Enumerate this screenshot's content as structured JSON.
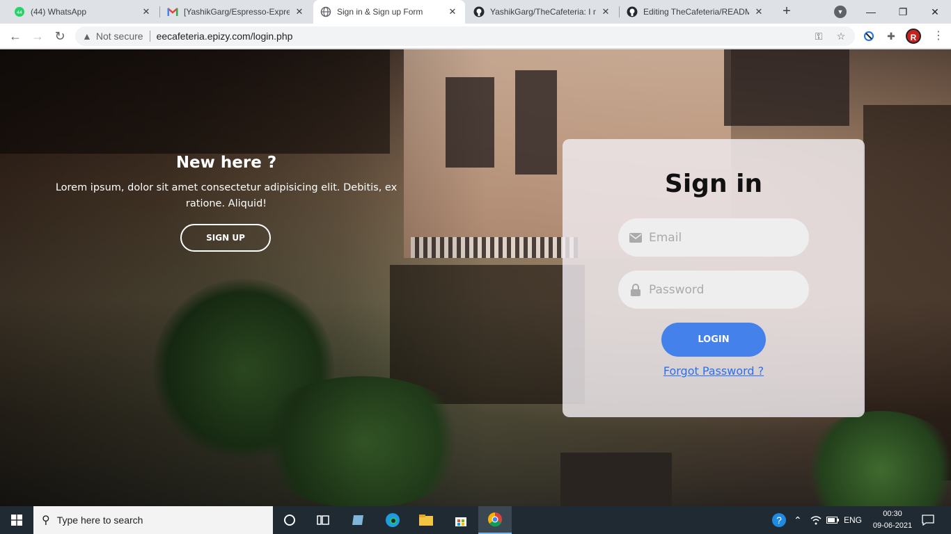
{
  "browser": {
    "tabs": [
      {
        "title": "(44) WhatsApp",
        "icon": "whatsapp-icon",
        "badge": "44"
      },
      {
        "title": "[YashikGarg/Espresso-Express",
        "icon": "gmail-icon"
      },
      {
        "title": "Sign in & Sign up Form",
        "icon": "globe-icon",
        "active": true
      },
      {
        "title": "YashikGarg/TheCafeteria: I m",
        "icon": "github-icon"
      },
      {
        "title": "Editing TheCafeteria/READM",
        "icon": "github-icon"
      }
    ],
    "omnibox": {
      "security_label": "Not secure",
      "url": "eecafeteria.epizy.com/login.php"
    },
    "profile_initial": "R"
  },
  "page": {
    "left_panel": {
      "heading": "New here ?",
      "text": "Lorem ipsum, dolor sit amet consectetur adipisicing elit. Debitis, ex ratione. Aliquid!",
      "button": "SIGN UP"
    },
    "signin": {
      "title": "Sign in",
      "email_placeholder": "Email",
      "password_placeholder": "Password",
      "login_button": "LOGIN",
      "forgot_link": "Forgot Password ?"
    },
    "colors": {
      "accent": "#4481eb",
      "link": "#2a6ff0"
    }
  },
  "taskbar": {
    "search_placeholder": "Type here to search",
    "language": "ENG",
    "time": "00:30",
    "date": "09-06-2021"
  }
}
